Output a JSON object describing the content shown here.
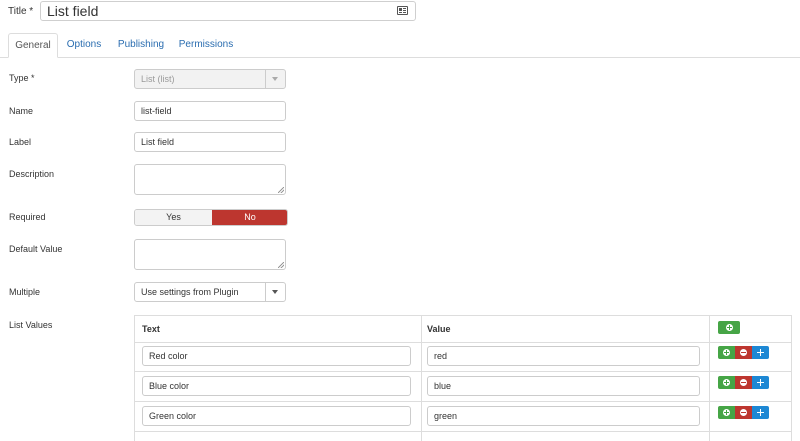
{
  "title": {
    "label": "Title *",
    "value": "List field"
  },
  "tabs": [
    {
      "label": "General",
      "active": true
    },
    {
      "label": "Options",
      "active": false
    },
    {
      "label": "Publishing",
      "active": false
    },
    {
      "label": "Permissions",
      "active": false
    }
  ],
  "form": {
    "type": {
      "label": "Type *",
      "value": "List (list)"
    },
    "name": {
      "label": "Name",
      "value": "list-field"
    },
    "label_field": {
      "label": "Label",
      "value": "List field"
    },
    "description": {
      "label": "Description",
      "value": ""
    },
    "required": {
      "label": "Required",
      "yes": "Yes",
      "no": "No",
      "selected": "No"
    },
    "default_value": {
      "label": "Default Value",
      "value": ""
    },
    "multiple": {
      "label": "Multiple",
      "value": "Use settings from Plugin"
    },
    "list_values": {
      "label": "List Values",
      "headers": {
        "text": "Text",
        "value": "Value"
      },
      "rows": [
        {
          "text": "Red color",
          "value": "red"
        },
        {
          "text": "Blue color",
          "value": "blue"
        },
        {
          "text": "Green color",
          "value": "green"
        }
      ]
    }
  },
  "colors": {
    "accent_red": "#bd362f",
    "accent_green": "#46a546",
    "accent_blue": "#1e88d4",
    "link_blue": "#2a6db0"
  },
  "icons": {
    "title_field": "contact-card-icon",
    "add_row": "plus-circle-icon",
    "remove_row": "minus-circle-icon",
    "move_row": "move-icon"
  }
}
